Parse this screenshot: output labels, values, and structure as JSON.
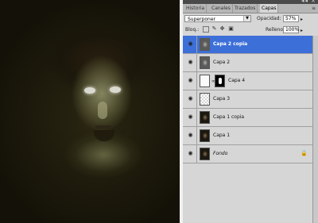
{
  "panel": {
    "collapse_arrows": "◂◂",
    "close": "×",
    "tabs": [
      {
        "label": "Historia"
      },
      {
        "label": "Canales"
      },
      {
        "label": "Trazados"
      },
      {
        "label": "Capas"
      }
    ],
    "menu_icon": "≡",
    "blend_mode": "Superponer",
    "opacity_label": "Opacidad:",
    "opacity_value": "57%",
    "lock_label": "Bloq.:",
    "fill_label": "Relleno:",
    "fill_value": "100%"
  },
  "layers": [
    {
      "name": "Capa 2 copia",
      "selected": true
    },
    {
      "name": "Capa 2"
    },
    {
      "name": "Capa 4"
    },
    {
      "name": "Capa 3"
    },
    {
      "name": "Capa 1 copia"
    },
    {
      "name": "Capa 1"
    },
    {
      "name": "Fondo"
    }
  ],
  "colors": {
    "selection": "#3d6fd8",
    "panel_bg": "#d6d6d6",
    "canvas_bg": "#141208"
  },
  "icons": {
    "visibility": "eye-icon",
    "lock": "lock-icon",
    "chain": "chain-link-icon"
  }
}
